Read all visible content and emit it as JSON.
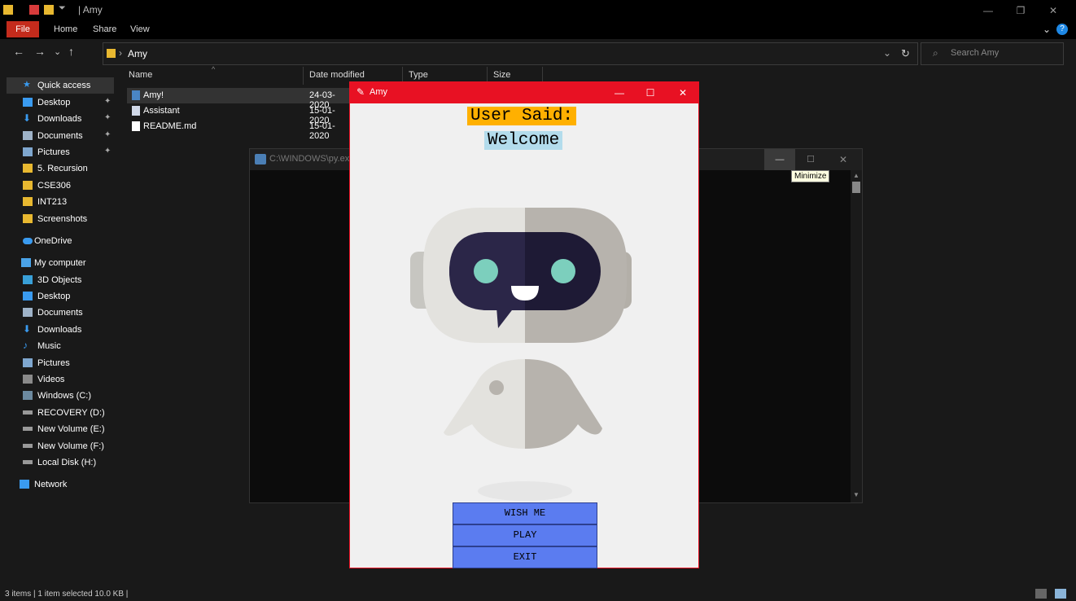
{
  "titlebar": {
    "title": "| Amy"
  },
  "ribbon": {
    "tabs": [
      "File",
      "Home",
      "Share",
      "View"
    ]
  },
  "address": {
    "path": "Amy",
    "search_placeholder": "Search Amy"
  },
  "sidebar": {
    "items": [
      {
        "label": "Quick access",
        "pin": ""
      },
      {
        "label": "Desktop",
        "pin": "📌"
      },
      {
        "label": "Downloads",
        "pin": "📌"
      },
      {
        "label": "Documents",
        "pin": "📌"
      },
      {
        "label": "Pictures",
        "pin": "📌"
      },
      {
        "label": "5. Recursion",
        "pin": ""
      },
      {
        "label": "CSE306",
        "pin": ""
      },
      {
        "label": "INT213",
        "pin": ""
      },
      {
        "label": "Screenshots",
        "pin": ""
      },
      {
        "label": "OneDrive",
        "pin": ""
      },
      {
        "label": "My computer",
        "pin": ""
      },
      {
        "label": "3D Objects",
        "pin": ""
      },
      {
        "label": "Desktop",
        "pin": ""
      },
      {
        "label": "Documents",
        "pin": ""
      },
      {
        "label": "Downloads",
        "pin": ""
      },
      {
        "label": "Music",
        "pin": ""
      },
      {
        "label": "Pictures",
        "pin": ""
      },
      {
        "label": "Videos",
        "pin": ""
      },
      {
        "label": "Windows (C:)",
        "pin": ""
      },
      {
        "label": "RECOVERY (D:)",
        "pin": ""
      },
      {
        "label": "New Volume (E:)",
        "pin": ""
      },
      {
        "label": "New Volume (F:)",
        "pin": ""
      },
      {
        "label": "Local Disk (H:)",
        "pin": ""
      },
      {
        "label": "Network",
        "pin": ""
      }
    ]
  },
  "filelist": {
    "columns": [
      "Name",
      "Date modified",
      "Type",
      "Size"
    ],
    "rows": [
      {
        "name": "Amy!",
        "date": "24-03-2020"
      },
      {
        "name": "Assistant",
        "date": "15-01-2020"
      },
      {
        "name": "README.md",
        "date": "15-01-2020"
      }
    ]
  },
  "console": {
    "title": "C:\\WINDOWS\\py.exe",
    "tooltip": "Minimize"
  },
  "app": {
    "title": "Amy",
    "user_said": "User Said:",
    "heard": "Welcome",
    "buttons": [
      "WISH ME",
      "PLAY",
      "EXIT"
    ]
  },
  "status": {
    "text": "3 items  |  1 item selected  10.0 KB  |"
  }
}
